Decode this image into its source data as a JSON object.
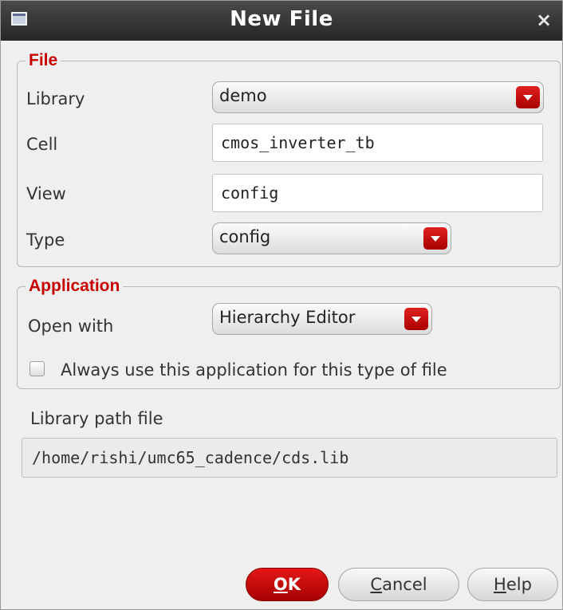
{
  "window": {
    "title": "New File",
    "icon": "window-icon",
    "close_icon": "close-icon",
    "close_glyph": "×"
  },
  "file_group": {
    "legend": "File",
    "library_label": "Library",
    "library_value": "demo",
    "cell_label": "Cell",
    "cell_value": "cmos_inverter_tb",
    "view_label": "View",
    "view_value": "config",
    "type_label": "Type",
    "type_value": "config"
  },
  "application_group": {
    "legend": "Application",
    "open_with_label": "Open with",
    "open_with_value": "Hierarchy Editor",
    "always_use_label": "Always use this application for this type of file",
    "always_use_checked": false
  },
  "library_path": {
    "label": "Library path file",
    "value": "/home/rishi/umc65_cadence/cds.lib"
  },
  "buttons": {
    "ok_mnemonic": "O",
    "ok_rest": "K",
    "cancel_mnemonic": "C",
    "cancel_rest": "ancel",
    "help_mnemonic": "H",
    "help_rest": "elp"
  },
  "colors": {
    "accent_red": "#c80000",
    "titlebar": "#333333",
    "dialog_bg": "#efefef"
  }
}
